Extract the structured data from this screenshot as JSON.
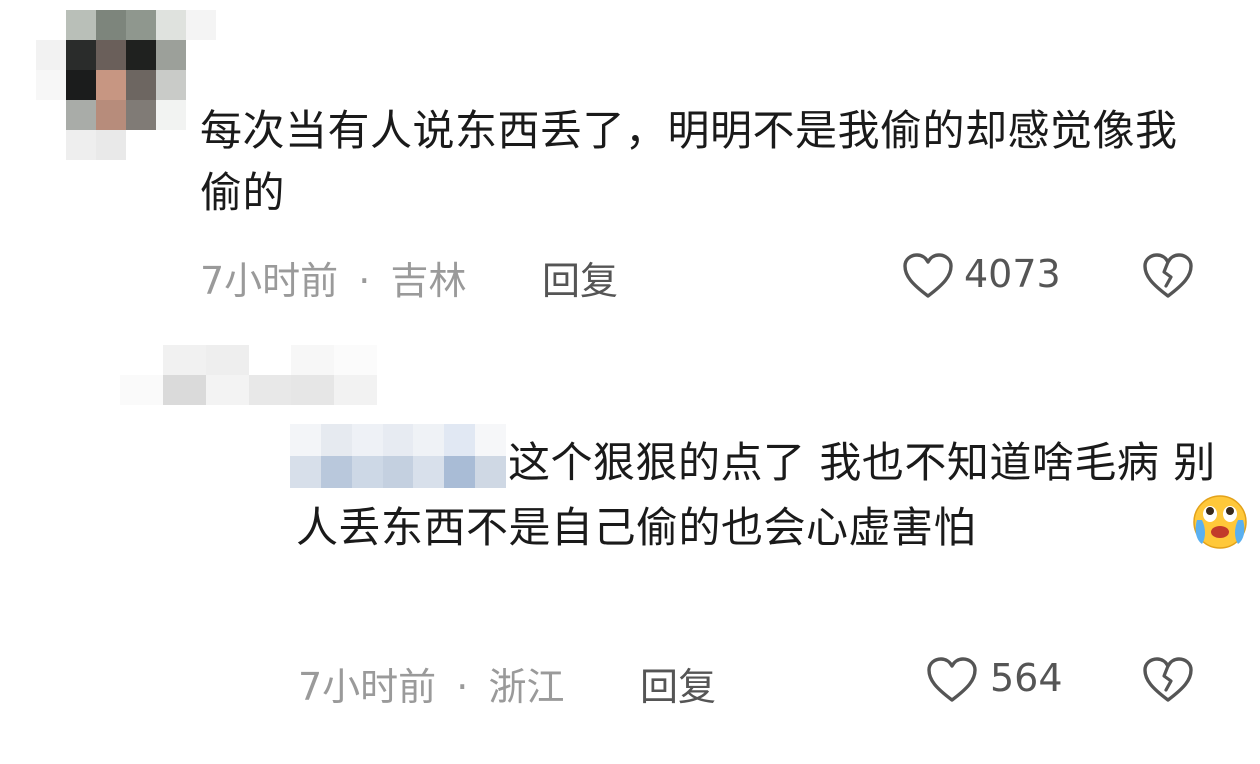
{
  "comments": [
    {
      "text": "每次当有人说东西丢了，明明不是我偷的却感觉像我偷的",
      "time": "7小时前",
      "location": "吉林",
      "reply_label": "回复",
      "likes": "4073"
    },
    {
      "text": "这个狠狠的点了 我也不知道啥毛病 别人丢东西不是自己偷的也会心虚害怕",
      "time": "7小时前",
      "location": "浙江",
      "reply_label": "回复",
      "likes": "564",
      "emoji": "crying-face-emoji"
    }
  ],
  "separator": "·",
  "icons": {
    "like": "heart-outline-icon",
    "dislike": "broken-heart-icon"
  },
  "colors": {
    "text": "#1a1a1a",
    "meta": "#9a9a9a",
    "action": "#555555"
  }
}
